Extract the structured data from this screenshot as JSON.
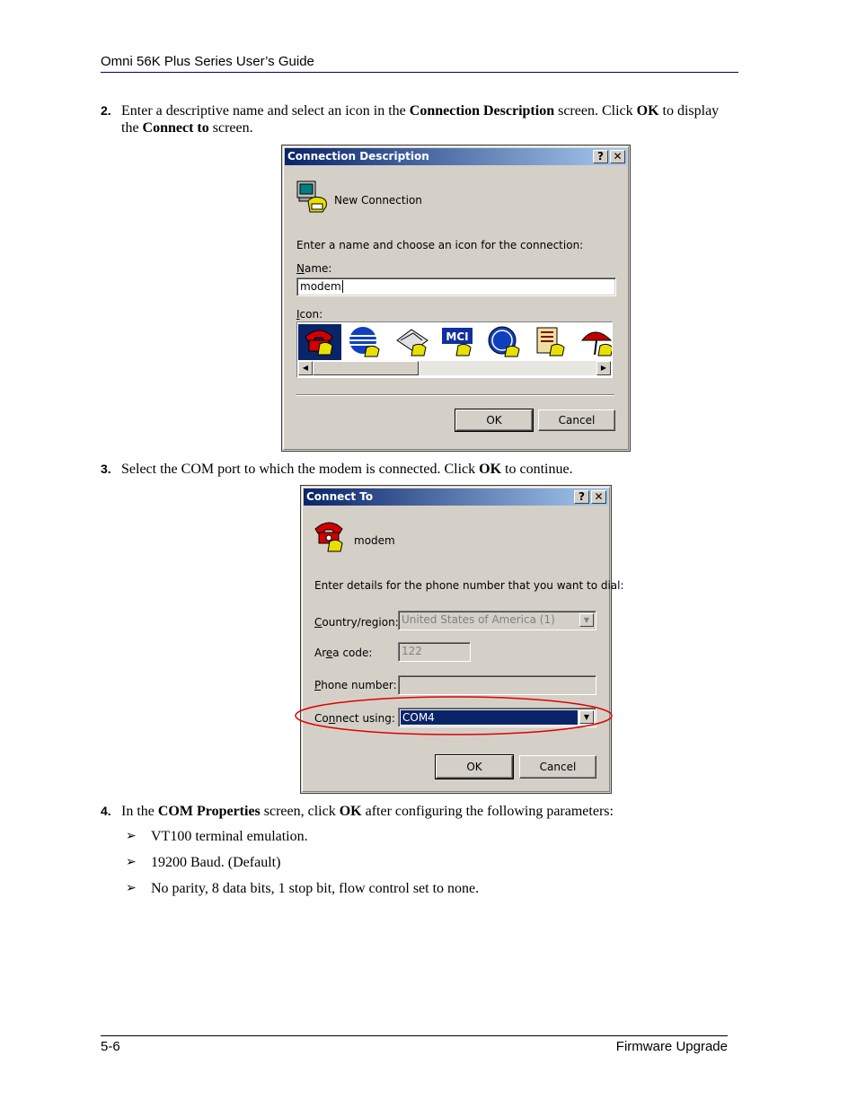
{
  "header": {
    "title": "Omni 56K Plus Series User’s Guide"
  },
  "footer": {
    "page": "5-6",
    "section": "Firmware Upgrade"
  },
  "steps": [
    {
      "num": "2.",
      "parts": [
        "Enter a descriptive name and select an icon in the ",
        "Connection Description",
        " screen. Click ",
        "OK",
        " to display the ",
        "Connect to",
        " screen."
      ]
    },
    {
      "num": "3.",
      "parts": [
        "Select the COM port to which the modem is connected. Click ",
        "OK",
        " to continue."
      ]
    },
    {
      "num": "4.",
      "parts": [
        "In the ",
        "COM Properties",
        " screen, click ",
        "OK",
        " after configuring the following parameters:"
      ]
    }
  ],
  "bullets": [
    "VT100 terminal emulation.",
    "19200 Baud. (Default)",
    "No parity, 8 data bits, 1 stop bit, flow control set to none."
  ],
  "dialog1": {
    "title": "Connection Description",
    "help_btn": "?",
    "close_btn": "✕",
    "heading": "New Connection",
    "prompt": "Enter a name and choose an icon for the connection:",
    "name_label": "Name:",
    "name_value": "modem",
    "icon_label": "Icon:",
    "icons": [
      "red-phone-icon",
      "globe-phone-icon",
      "fax-phone-icon",
      "mci-phone-icon",
      "ge-phone-icon",
      "document-phone-icon",
      "umbrella-phone-icon"
    ],
    "mci_text": "MCI",
    "ok": "OK",
    "cancel": "Cancel"
  },
  "dialog2": {
    "title": "Connect To",
    "help_btn": "?",
    "close_btn": "✕",
    "heading": "modem",
    "prompt": "Enter details for the phone number that you want to dial:",
    "country_label": "Country/region:",
    "country_value": "United States of America (1)",
    "area_label": "Area code:",
    "area_value": "122",
    "phone_label": "Phone number:",
    "phone_value": "",
    "connect_label": "Connect using:",
    "connect_value": "COM4",
    "ok": "OK",
    "cancel": "Cancel"
  },
  "colors": {
    "titlebar_start": "#0a246a",
    "titlebar_end": "#a6caf0",
    "highlight": "#0a246a",
    "callout": "#e00000"
  }
}
